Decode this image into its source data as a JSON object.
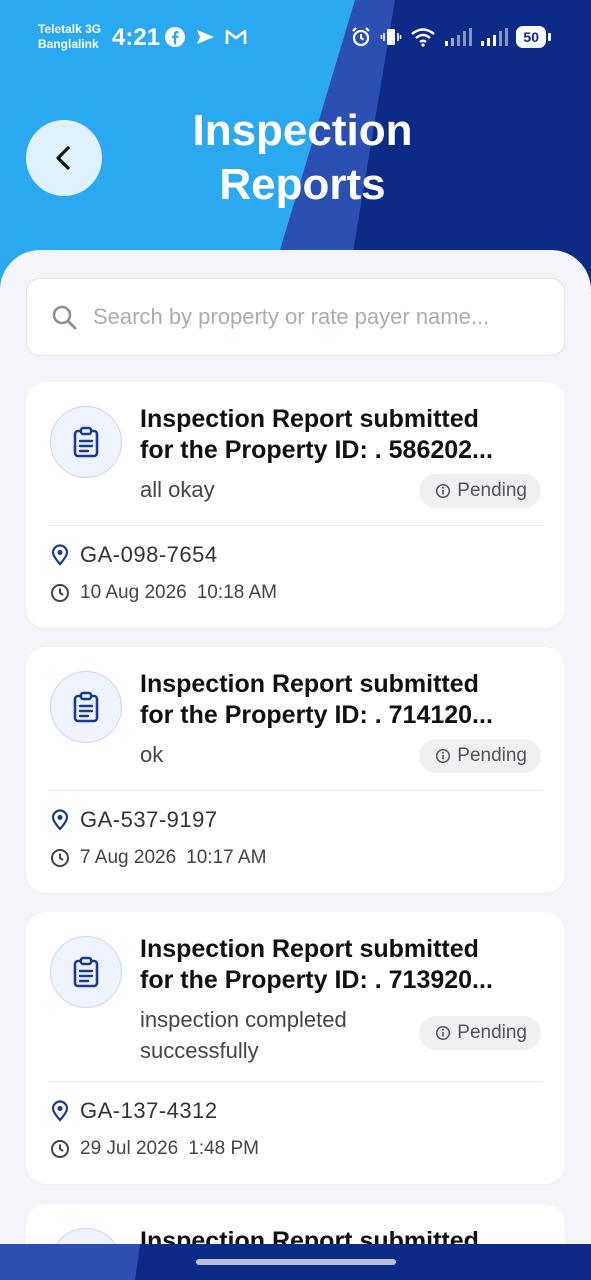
{
  "status_bar": {
    "carrier_1": "Teletalk 3G",
    "carrier_2": "Banglalink",
    "time": "4:21",
    "left_icons": [
      "facebook-icon",
      "send-icon",
      "gmail-icon"
    ],
    "right_icons": [
      "alarm-icon",
      "vibrate-icon",
      "wifi-icon",
      "signal-icon",
      "signal-icon"
    ],
    "battery": "50"
  },
  "header": {
    "title_line1": "Inspection",
    "title_line2": "Reports",
    "back_icon": "chevron-left-icon",
    "colors": {
      "light_blue": "#2aa8f0",
      "mid_blue": "#2b4fb3",
      "dark_blue": "#0c2b86"
    }
  },
  "search": {
    "placeholder": "Search by property or rate payer name...",
    "value": "",
    "icon": "search-icon"
  },
  "reports": [
    {
      "title_line1": "Inspection Report submitted",
      "title_line2": "for the Property ID: . 586202...",
      "description": "all okay",
      "status": "Pending",
      "property_code": "GA-098-7654",
      "date": "10 Aug 2026",
      "time": "10:18 AM"
    },
    {
      "title_line1": "Inspection Report submitted",
      "title_line2": "for the Property ID: . 714120...",
      "description": "ok",
      "status": "Pending",
      "property_code": "GA-537-9197",
      "date": "7 Aug 2026",
      "time": "10:17 AM"
    },
    {
      "title_line1": "Inspection Report submitted",
      "title_line2": "for the Property ID: . 713920...",
      "description": "inspection completed successfully",
      "status": "Pending",
      "property_code": "GA-137-4312",
      "date": "29 Jul 2026",
      "time": "1:48 PM"
    },
    {
      "title_line1": "Inspection Report submitted"
    }
  ],
  "colors": {
    "accent": "#1a3a8c",
    "status_pending_bg": "#eef0f3"
  }
}
